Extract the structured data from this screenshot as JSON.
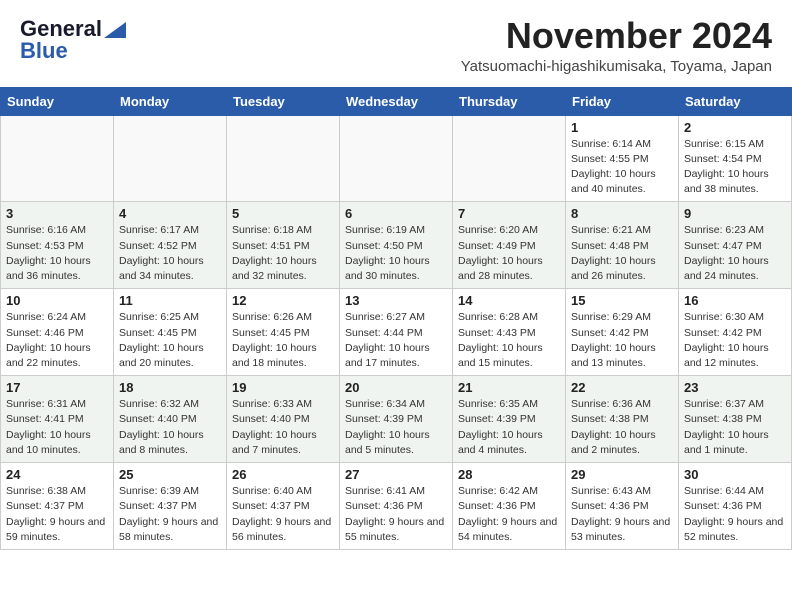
{
  "logo": {
    "line1": "General",
    "line2": "Blue"
  },
  "title": "November 2024",
  "location": "Yatsuomachi-higashikumisaka, Toyama, Japan",
  "days_of_week": [
    "Sunday",
    "Monday",
    "Tuesday",
    "Wednesday",
    "Thursday",
    "Friday",
    "Saturday"
  ],
  "weeks": [
    [
      {
        "day": "",
        "info": ""
      },
      {
        "day": "",
        "info": ""
      },
      {
        "day": "",
        "info": ""
      },
      {
        "day": "",
        "info": ""
      },
      {
        "day": "",
        "info": ""
      },
      {
        "day": "1",
        "info": "Sunrise: 6:14 AM\nSunset: 4:55 PM\nDaylight: 10 hours and 40 minutes."
      },
      {
        "day": "2",
        "info": "Sunrise: 6:15 AM\nSunset: 4:54 PM\nDaylight: 10 hours and 38 minutes."
      }
    ],
    [
      {
        "day": "3",
        "info": "Sunrise: 6:16 AM\nSunset: 4:53 PM\nDaylight: 10 hours and 36 minutes."
      },
      {
        "day": "4",
        "info": "Sunrise: 6:17 AM\nSunset: 4:52 PM\nDaylight: 10 hours and 34 minutes."
      },
      {
        "day": "5",
        "info": "Sunrise: 6:18 AM\nSunset: 4:51 PM\nDaylight: 10 hours and 32 minutes."
      },
      {
        "day": "6",
        "info": "Sunrise: 6:19 AM\nSunset: 4:50 PM\nDaylight: 10 hours and 30 minutes."
      },
      {
        "day": "7",
        "info": "Sunrise: 6:20 AM\nSunset: 4:49 PM\nDaylight: 10 hours and 28 minutes."
      },
      {
        "day": "8",
        "info": "Sunrise: 6:21 AM\nSunset: 4:48 PM\nDaylight: 10 hours and 26 minutes."
      },
      {
        "day": "9",
        "info": "Sunrise: 6:23 AM\nSunset: 4:47 PM\nDaylight: 10 hours and 24 minutes."
      }
    ],
    [
      {
        "day": "10",
        "info": "Sunrise: 6:24 AM\nSunset: 4:46 PM\nDaylight: 10 hours and 22 minutes."
      },
      {
        "day": "11",
        "info": "Sunrise: 6:25 AM\nSunset: 4:45 PM\nDaylight: 10 hours and 20 minutes."
      },
      {
        "day": "12",
        "info": "Sunrise: 6:26 AM\nSunset: 4:45 PM\nDaylight: 10 hours and 18 minutes."
      },
      {
        "day": "13",
        "info": "Sunrise: 6:27 AM\nSunset: 4:44 PM\nDaylight: 10 hours and 17 minutes."
      },
      {
        "day": "14",
        "info": "Sunrise: 6:28 AM\nSunset: 4:43 PM\nDaylight: 10 hours and 15 minutes."
      },
      {
        "day": "15",
        "info": "Sunrise: 6:29 AM\nSunset: 4:42 PM\nDaylight: 10 hours and 13 minutes."
      },
      {
        "day": "16",
        "info": "Sunrise: 6:30 AM\nSunset: 4:42 PM\nDaylight: 10 hours and 12 minutes."
      }
    ],
    [
      {
        "day": "17",
        "info": "Sunrise: 6:31 AM\nSunset: 4:41 PM\nDaylight: 10 hours and 10 minutes."
      },
      {
        "day": "18",
        "info": "Sunrise: 6:32 AM\nSunset: 4:40 PM\nDaylight: 10 hours and 8 minutes."
      },
      {
        "day": "19",
        "info": "Sunrise: 6:33 AM\nSunset: 4:40 PM\nDaylight: 10 hours and 7 minutes."
      },
      {
        "day": "20",
        "info": "Sunrise: 6:34 AM\nSunset: 4:39 PM\nDaylight: 10 hours and 5 minutes."
      },
      {
        "day": "21",
        "info": "Sunrise: 6:35 AM\nSunset: 4:39 PM\nDaylight: 10 hours and 4 minutes."
      },
      {
        "day": "22",
        "info": "Sunrise: 6:36 AM\nSunset: 4:38 PM\nDaylight: 10 hours and 2 minutes."
      },
      {
        "day": "23",
        "info": "Sunrise: 6:37 AM\nSunset: 4:38 PM\nDaylight: 10 hours and 1 minute."
      }
    ],
    [
      {
        "day": "24",
        "info": "Sunrise: 6:38 AM\nSunset: 4:37 PM\nDaylight: 9 hours and 59 minutes."
      },
      {
        "day": "25",
        "info": "Sunrise: 6:39 AM\nSunset: 4:37 PM\nDaylight: 9 hours and 58 minutes."
      },
      {
        "day": "26",
        "info": "Sunrise: 6:40 AM\nSunset: 4:37 PM\nDaylight: 9 hours and 56 minutes."
      },
      {
        "day": "27",
        "info": "Sunrise: 6:41 AM\nSunset: 4:36 PM\nDaylight: 9 hours and 55 minutes."
      },
      {
        "day": "28",
        "info": "Sunrise: 6:42 AM\nSunset: 4:36 PM\nDaylight: 9 hours and 54 minutes."
      },
      {
        "day": "29",
        "info": "Sunrise: 6:43 AM\nSunset: 4:36 PM\nDaylight: 9 hours and 53 minutes."
      },
      {
        "day": "30",
        "info": "Sunrise: 6:44 AM\nSunset: 4:36 PM\nDaylight: 9 hours and 52 minutes."
      }
    ]
  ]
}
